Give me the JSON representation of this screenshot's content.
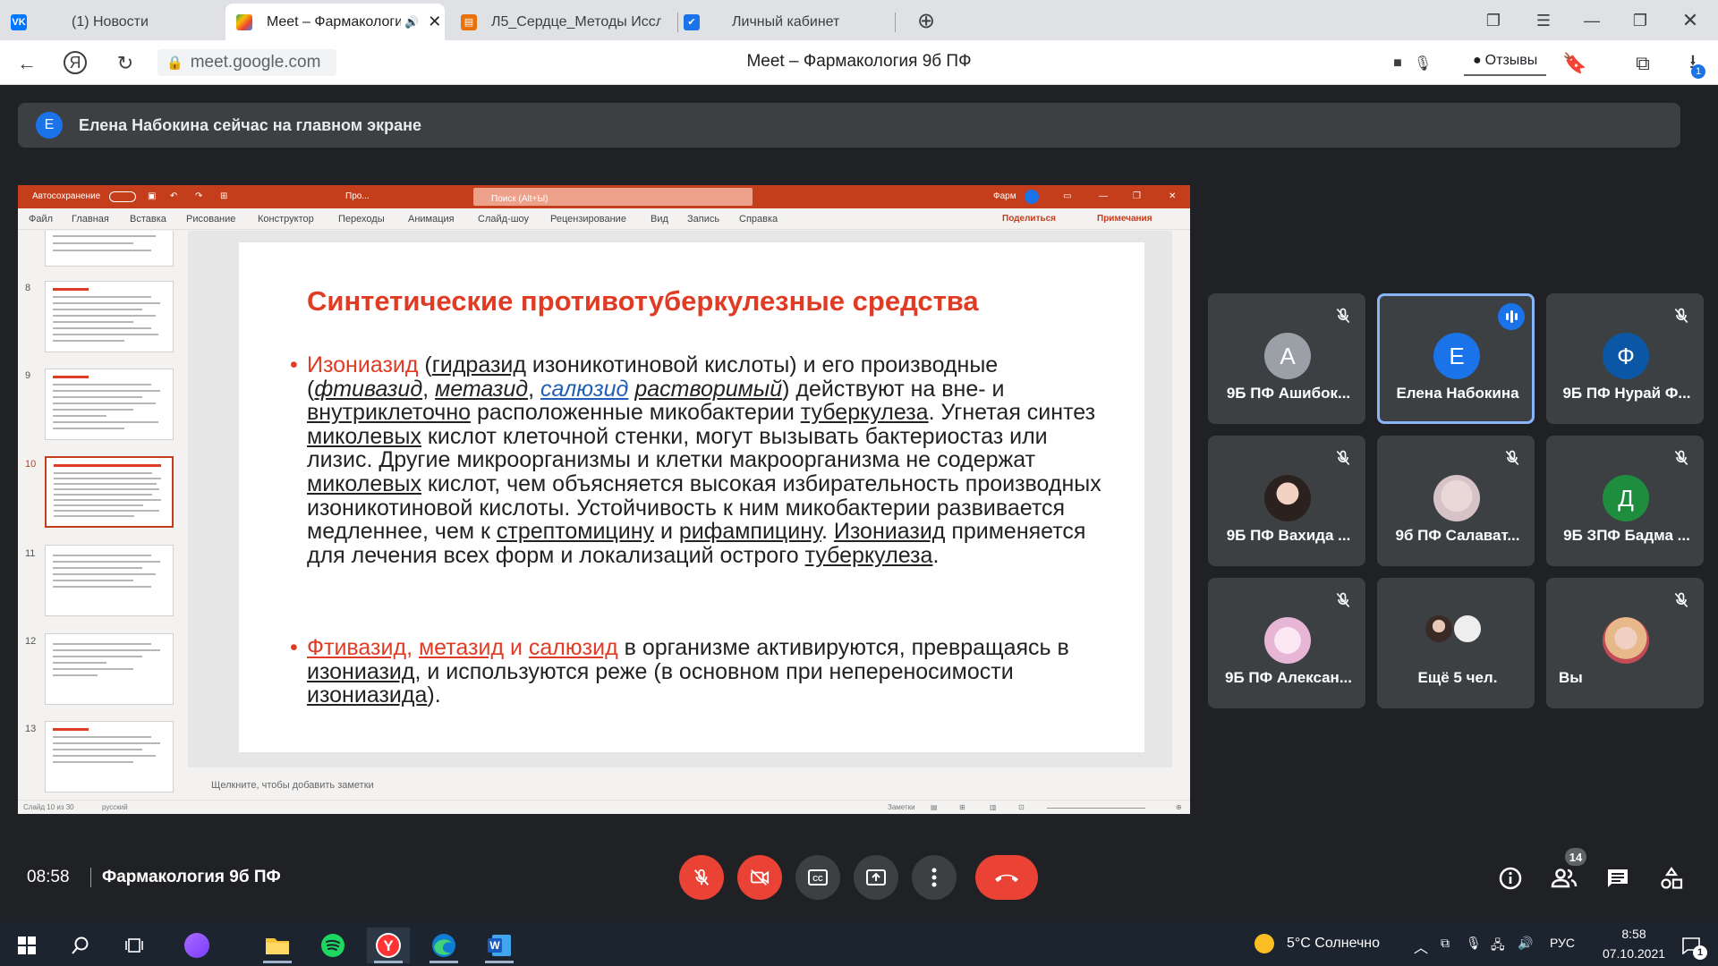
{
  "browser": {
    "tabs": [
      {
        "title": "(1) Новости",
        "favicon": "vk-icon"
      },
      {
        "title": "Meet – Фармакологи",
        "favicon": "google-meet-icon"
      },
      {
        "title": "Л5_Сердце_Методы Иссле",
        "favicon": "document-icon"
      },
      {
        "title": "Личный кабинет",
        "favicon": "shield-icon"
      }
    ],
    "url": "meet.google.com",
    "page_title": "Meet – Фармакология 9б ПФ",
    "feedback_label": "Отзывы",
    "download_badge": "1"
  },
  "meet": {
    "presenter_initial": "E",
    "banner": "Елена Набокина сейчас на главном экране",
    "time": "08:58",
    "meeting_name": "Фармакология 9б ПФ",
    "participants_count": "14",
    "participants": [
      {
        "initial": "A",
        "name": "9Б ПФ Ашибок...",
        "color": "#9aa0a6",
        "muted": true
      },
      {
        "initial": "E",
        "name": "Елена Набокина",
        "color": "#1a73e8",
        "muted": false,
        "speaking": true
      },
      {
        "initial": "Ф",
        "name": "9Б ПФ Нурай Ф...",
        "color": "#0b57a5",
        "muted": true
      },
      {
        "initial": "",
        "name": "9Б ПФ Вахида ...",
        "color": "",
        "muted": true,
        "photo": true
      },
      {
        "initial": "",
        "name": "9б ПФ Салават...",
        "color": "",
        "muted": true,
        "photo": true
      },
      {
        "initial": "Д",
        "name": "9Б ЗПФ Бадма ...",
        "color": "#1e8e3e",
        "muted": true
      },
      {
        "initial": "",
        "name": "9Б ПФ Алексан...",
        "color": "",
        "muted": true,
        "photo": true
      },
      {
        "initial": "",
        "name": "Ещё 5 чел.",
        "color": "",
        "muted": false,
        "group": true
      },
      {
        "initial": "",
        "name": "Вы",
        "color": "",
        "muted": true,
        "photo": true
      }
    ]
  },
  "ppt": {
    "autosave": "Автосохранение",
    "file_short": "Про...",
    "search": "Поиск (Alt+Ы)",
    "user": "Фарм",
    "menu": [
      "Файл",
      "Главная",
      "Вставка",
      "Рисование",
      "Конструктор",
      "Переходы",
      "Анимация",
      "Слайд-шоу",
      "Рецензирование",
      "Вид",
      "Запись",
      "Справка"
    ],
    "share": "Поделиться",
    "comments": "Примечания",
    "thumb_numbers": [
      "8",
      "9",
      "10",
      "11",
      "12",
      "13"
    ],
    "selected_thumb": "10",
    "notes_placeholder": "Щелкните, чтобы добавить заметки",
    "status_slide": "Слайд 10 из 30",
    "status_lang": "русский",
    "status_notes": "Заметки",
    "slide": {
      "title": "Синтетические противотуберкулезные средства",
      "p1": {
        "t1": "Изониазид",
        "t2": " (",
        "t3": "гидразид",
        "t4": " изоникотиновой кислоты) и его производные (",
        "t5": "фтивазид",
        "t6": ", ",
        "t7": "метазид",
        "t8": ", ",
        "t9": "салюзид",
        "t10": " ",
        "t11": "растворимый",
        "t12": ") действуют на вне- и ",
        "t13": "внутриклеточно",
        "t14": " расположенные микобактерии ",
        "t15": "туберкулеза",
        "t16": ". Угнетая синтез ",
        "t17": "миколевых",
        "t18": " кислот клеточной стенки, могут вызывать бактериостаз или лизис. Другие микроорганизмы и клетки макроорганизма не содержат ",
        "t19": "миколевых",
        "t20": " кислот, чем объясняется высокая избирательность производных изоникотиновой кислоты. Устойчивость к ним микобактерии развивается медленнее, чем к ",
        "t21": "стрептомицину",
        "t22": " и ",
        "t23": "рифампицину",
        "t24": ". ",
        "t25": "Изониазид",
        "t26": " применяется для лечения всех форм и локализаций острого ",
        "t27": "туберкулеза",
        "t28": "."
      },
      "p2": {
        "t1": "Фтивазид",
        "t2": ", ",
        "t3": "метазид",
        "t4": " и ",
        "t5": "салюзид",
        "t6": " в организме активируются, превращаясь в ",
        "t7": "изониазид",
        "t8": ", и используются реже (в основном при непереносимости ",
        "t9": "изониазида",
        "t10": ")."
      }
    }
  },
  "taskbar": {
    "weather": "5°C  Солнечно",
    "lang": "РУС",
    "time": "8:58",
    "date": "07.10.2021",
    "notifications": "1"
  }
}
